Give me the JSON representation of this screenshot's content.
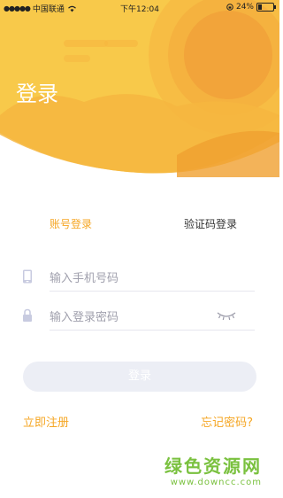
{
  "status_bar": {
    "carrier": "中国联通",
    "time": "下午12:04",
    "battery_percent": "24%"
  },
  "header": {
    "title": "登录"
  },
  "tabs": [
    {
      "label": "账号登录",
      "active": true
    },
    {
      "label": "验证码登录",
      "active": false
    }
  ],
  "form": {
    "phone_placeholder": "输入手机号码",
    "password_placeholder": "输入登录密码",
    "submit_label": "登录"
  },
  "links": {
    "register": "立即注册",
    "forgot_password": "忘记密码?"
  },
  "watermark": {
    "line1": "绿色资源网",
    "line2": "www.downcc.com"
  },
  "colors": {
    "accent": "#f5a623",
    "header_yellow": "#f8c94a",
    "sun_orange": "#f2a43a",
    "button_disabled": "#eceef5",
    "watermark_green": "#7ac13f"
  }
}
